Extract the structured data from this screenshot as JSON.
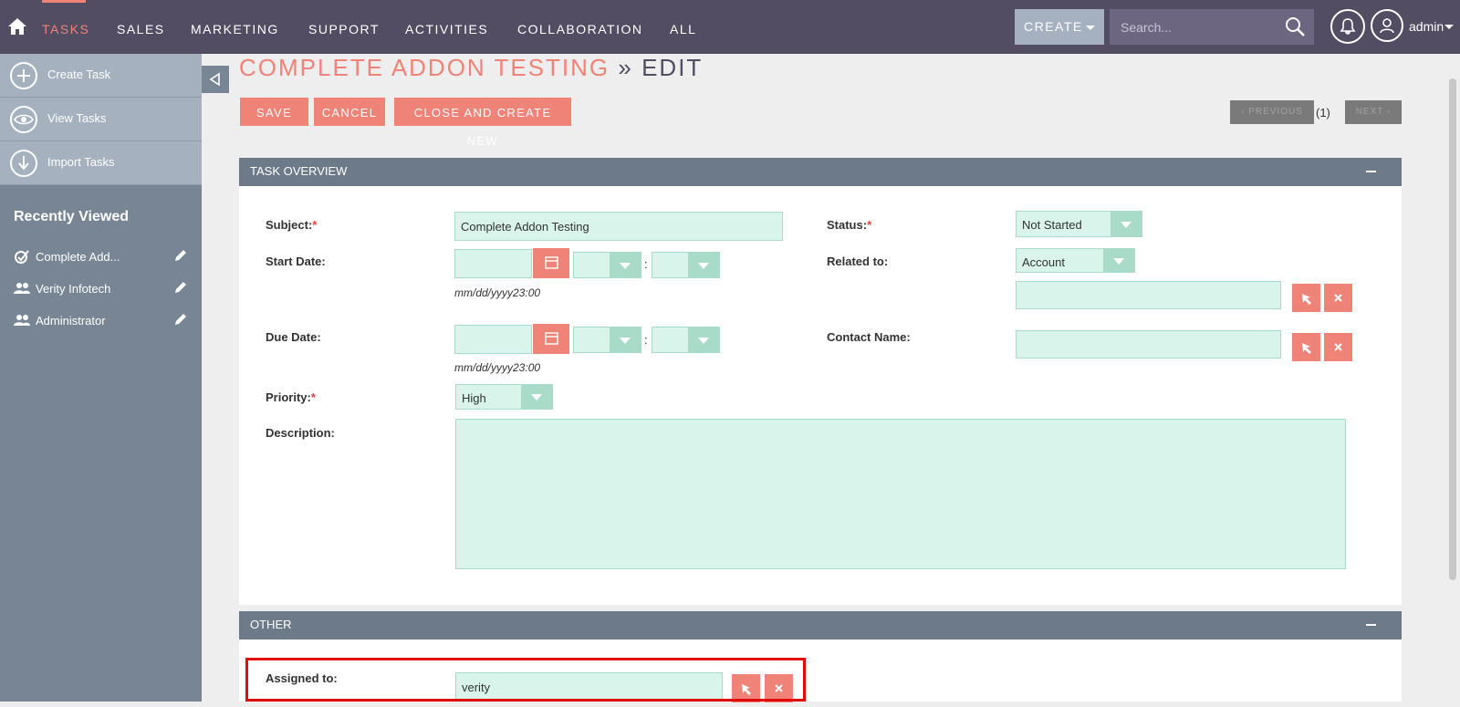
{
  "nav": {
    "items": [
      "TASKS",
      "SALES",
      "MARKETING",
      "SUPPORT",
      "ACTIVITIES",
      "COLLABORATION",
      "ALL"
    ],
    "create_label": "CREATE",
    "search_placeholder": "Search...",
    "user": "admin",
    "accent": "#f08377",
    "bg": "#534d64"
  },
  "sidebar": {
    "actions": [
      "Create Task",
      "View Tasks",
      "Import Tasks"
    ],
    "recent_title": "Recently Viewed",
    "recent": [
      "Complete Add...",
      "Verity Infotech",
      "Administrator"
    ]
  },
  "page": {
    "title": "COMPLETE ADDON TESTING",
    "separator": "»",
    "mode": "EDIT",
    "buttons": {
      "save": "SAVE",
      "cancel": "CANCEL",
      "close_create": "CLOSE AND CREATE NEW"
    },
    "pagination": {
      "previous": "PREVIOUS",
      "count": "(1)",
      "next": "NEXT"
    }
  },
  "overview": {
    "header": "TASK OVERVIEW",
    "subject_label": "Subject:",
    "subject_value": "Complete Addon Testing",
    "status_label": "Status:",
    "status_value": "Not Started",
    "start_label": "Start Date:",
    "date_hint": "mm/dd/yyyy23:00",
    "related_label": "Related to:",
    "related_value": "Account",
    "due_label": "Due Date:",
    "contact_label": "Contact Name:",
    "priority_label": "Priority:",
    "priority_value": "High",
    "description_label": "Description:",
    "required_mark": "*",
    "time_sep": ":"
  },
  "other": {
    "header": "OTHER",
    "assigned_label": "Assigned to:",
    "assigned_value": "verity"
  }
}
